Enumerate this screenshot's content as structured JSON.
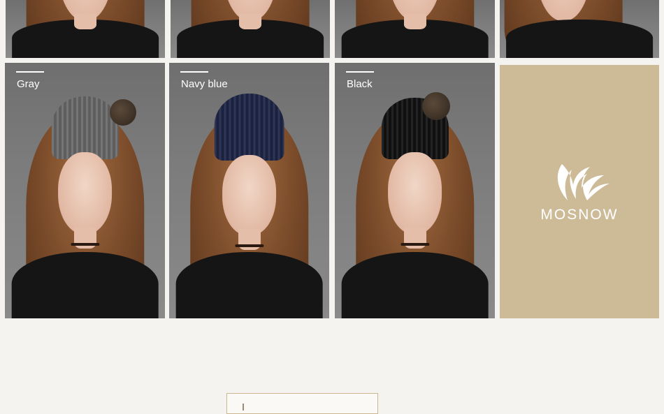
{
  "variants": [
    {
      "label": "Gray",
      "hat_color": "#6b6b6b",
      "pompom": true
    },
    {
      "label": "Navy blue",
      "hat_color": "#1f2748",
      "pompom": false
    },
    {
      "label": "Black",
      "hat_color": "#121212",
      "pompom": true
    }
  ],
  "brand": {
    "name": "MOSNOW",
    "logo_icon": "wing-leaf-logo-icon",
    "background": "#cdbb98"
  },
  "colors": {
    "page_background": "#f4f3ef",
    "label_text": "#ffffff",
    "shirt": "#151515",
    "hair": "#7a4b2a"
  }
}
